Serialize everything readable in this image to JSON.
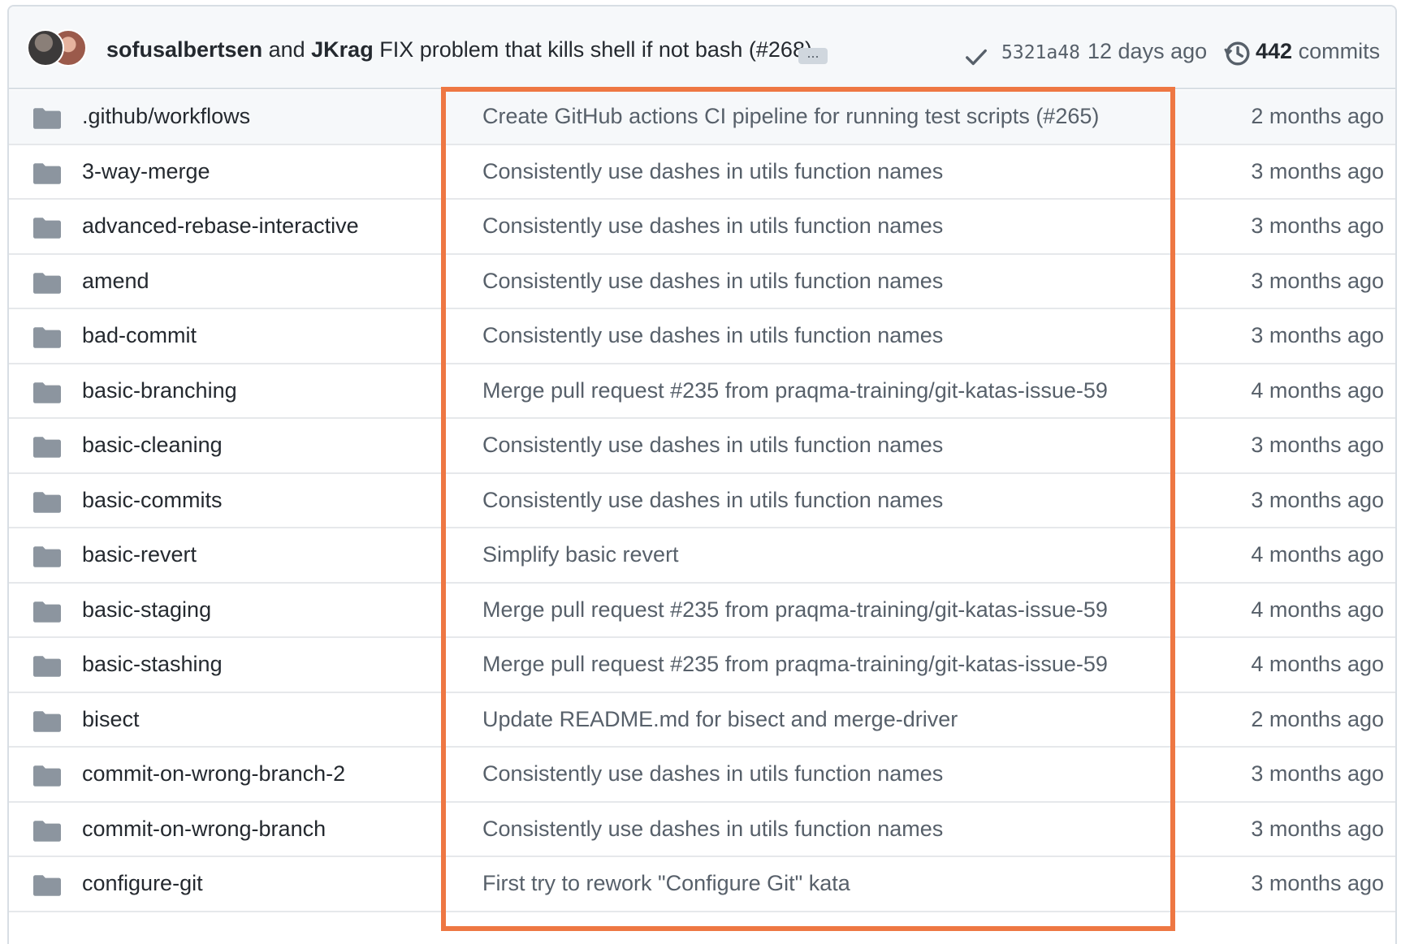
{
  "header": {
    "author1": "sofusalbertsen",
    "and_text": "and",
    "author2": "JKrag",
    "message": "FIX problem that kills shell if not bash (#268)",
    "ellipsis": "...",
    "sha": "5321a48",
    "ago": "12 days ago",
    "commits_count": "442",
    "commits_label": "commits"
  },
  "rows": [
    {
      "name": ".github/workflows",
      "message": "Create GitHub actions CI pipeline for running test scripts (#265)",
      "time": "2 months ago"
    },
    {
      "name": "3-way-merge",
      "message": "Consistently use dashes in utils function names",
      "time": "3 months ago"
    },
    {
      "name": "advanced-rebase-interactive",
      "message": "Consistently use dashes in utils function names",
      "time": "3 months ago"
    },
    {
      "name": "amend",
      "message": "Consistently use dashes in utils function names",
      "time": "3 months ago"
    },
    {
      "name": "bad-commit",
      "message": "Consistently use dashes in utils function names",
      "time": "3 months ago"
    },
    {
      "name": "basic-branching",
      "message": "Merge pull request #235 from praqma-training/git-katas-issue-59",
      "time": "4 months ago"
    },
    {
      "name": "basic-cleaning",
      "message": "Consistently use dashes in utils function names",
      "time": "3 months ago"
    },
    {
      "name": "basic-commits",
      "message": "Consistently use dashes in utils function names",
      "time": "3 months ago"
    },
    {
      "name": "basic-revert",
      "message": "Simplify basic revert",
      "time": "4 months ago"
    },
    {
      "name": "basic-staging",
      "message": "Merge pull request #235 from praqma-training/git-katas-issue-59",
      "time": "4 months ago"
    },
    {
      "name": "basic-stashing",
      "message": "Merge pull request #235 from praqma-training/git-katas-issue-59",
      "time": "4 months ago"
    },
    {
      "name": "bisect",
      "message": "Update README.md for bisect and merge-driver",
      "time": "2 months ago"
    },
    {
      "name": "commit-on-wrong-branch-2",
      "message": "Consistently use dashes in utils function names",
      "time": "3 months ago"
    },
    {
      "name": "commit-on-wrong-branch",
      "message": "Consistently use dashes in utils function names",
      "time": "3 months ago"
    },
    {
      "name": "configure-git",
      "message": "First try to rework \"Configure Git\" kata",
      "time": "3 months ago"
    }
  ],
  "colors": {
    "highlight": "#ee7743",
    "folder": "#8c959f"
  },
  "icons": {
    "row_icon": "folder-icon",
    "check": "check-icon",
    "history": "history-icon"
  }
}
